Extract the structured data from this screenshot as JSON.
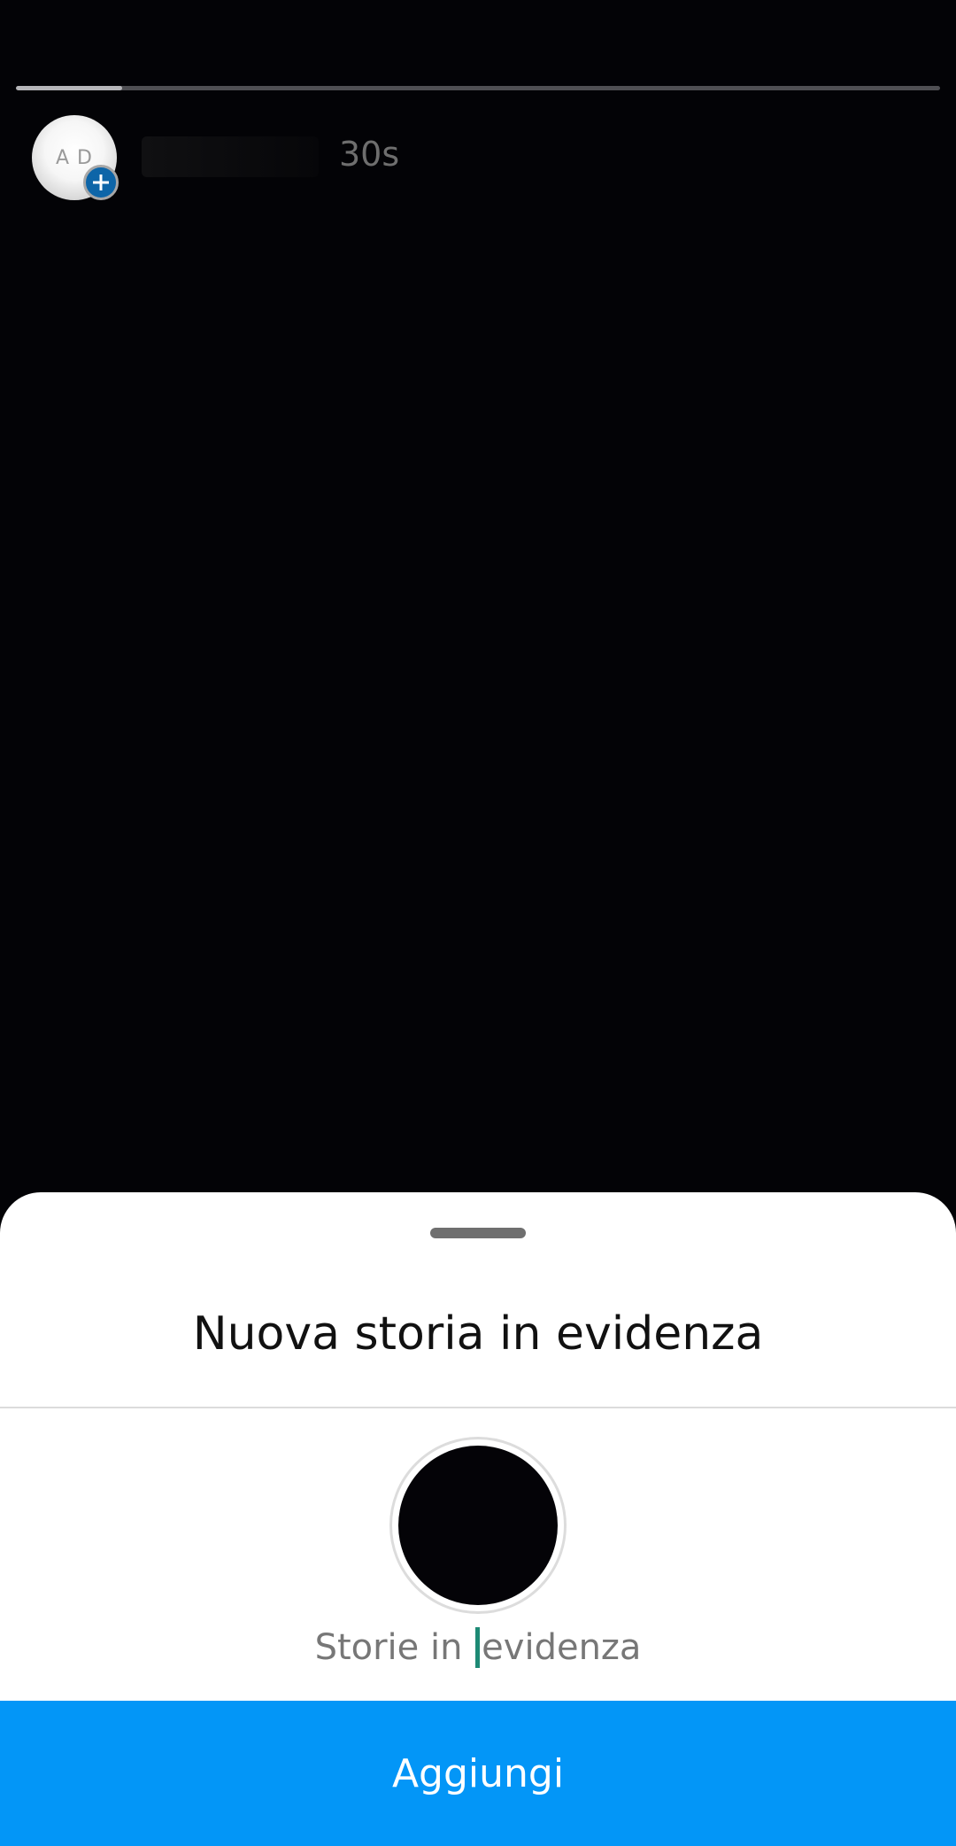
{
  "story": {
    "progress": 0.115,
    "timestamp": "30s",
    "avatar_text": "A D"
  },
  "sheet": {
    "title": "Nuova storia in evidenza",
    "name_before_caret": "Storie in ",
    "name_after_caret": "evidenza",
    "name_value": "Storie in evidenza",
    "add_label": "Aggiungi"
  },
  "colors": {
    "accent": "#0396F7",
    "caret": "#1D8A75",
    "avatar_badge": "#0D65A8"
  },
  "icons": {
    "avatar_badge": "plus-icon"
  }
}
